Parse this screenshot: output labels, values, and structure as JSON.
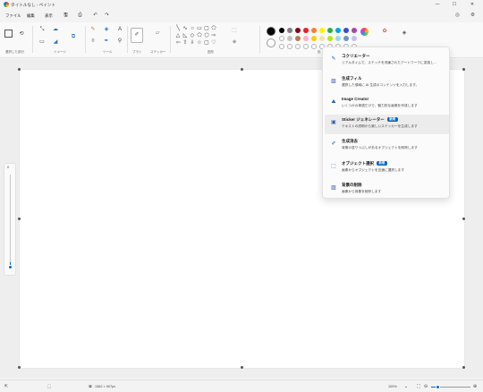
{
  "window": {
    "title": "タイトルなし - ペイント",
    "minimize": "—",
    "maximize": "☐",
    "close": "✕"
  },
  "menu": {
    "file": "ファイル",
    "edit": "編集",
    "view": "表示"
  },
  "ribbon": {
    "groups": {
      "selection": "選択した部分",
      "image": "イメージ",
      "tools": "ツール",
      "brushes": "ブラシ",
      "stickers": "ステッカー",
      "shapes": "図形",
      "colors": "色"
    },
    "palette_row1": [
      "#000000",
      "#7f7f7f",
      "#880015",
      "#ed1c24",
      "#ff7f27",
      "#fff200",
      "#22b14c",
      "#00a2e8",
      "#3f48cc",
      "#a349a4"
    ],
    "palette_row2": [
      "#ffffff",
      "#c3c3c3",
      "#b97a57",
      "#ffaec9",
      "#ffc90e",
      "#efe4b0",
      "#b5e61d",
      "#99d9ea",
      "#7092be",
      "#c8bfe7"
    ],
    "primary_color": "#000000",
    "secondary_color": "#ffffff"
  },
  "dropdown": {
    "items": [
      {
        "icon": "cocreator-icon",
        "title": "コクリエーター",
        "desc": "リアルタイムで、ステッチを洗練されたアートワークに変換し..."
      },
      {
        "icon": "generative-fill-icon",
        "title": "生成フィル",
        "desc": "選択した領域に AI 生成のコンテンツを入力します。"
      },
      {
        "icon": "image-creator-icon",
        "title": "Image Creator",
        "desc": "いくつかの単語だけで、魅力的な画像を作成します"
      },
      {
        "icon": "sticker-generator-icon",
        "title": "Sticker ジェネレーター",
        "badge": "新規",
        "desc": "テキストの説明から楽しいステッカーを生成します"
      },
      {
        "icon": "generative-erase-icon",
        "title": "生成消去",
        "desc": "背景の塗りつぶしがあるオブジェクトを削除します"
      },
      {
        "icon": "object-select-icon",
        "title": "オブジェクト選択",
        "badge": "新規",
        "desc": "画像からオブジェクトを迅速に選択します"
      },
      {
        "icon": "remove-background-icon",
        "title": "背景の削除",
        "desc": "画像から背景を削除します"
      }
    ]
  },
  "status": {
    "canvas_size": "1362 × 907px",
    "zoom": "100%"
  },
  "brush_size": 8
}
